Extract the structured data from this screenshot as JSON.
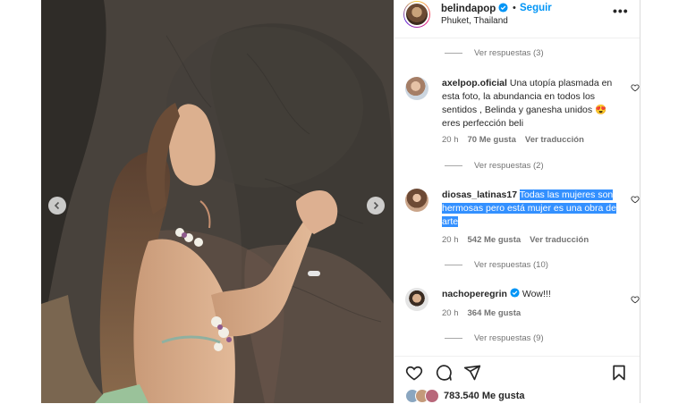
{
  "post": {
    "username": "belindapop",
    "follow_label": "Seguir",
    "dot": "•",
    "location": "Phuket, Thailand",
    "more": "•••"
  },
  "comments": [
    {
      "replies_before": "Ver respuestas (3)"
    },
    {
      "user": "axelpop.oficial",
      "text": "Una utopía plasmada en esta foto, la abundancia en todos los sentidos , Belinda y ganesha unidos 😍 eres perfección beli",
      "time": "20 h",
      "likes": "70 Me gusta",
      "translate": "Ver traducción",
      "replies": "Ver respuestas (2)"
    },
    {
      "user": "diosas_latinas17",
      "text": "Todas las mujeres son hermosas pero está mujer es una obra de arte",
      "time": "20 h",
      "likes": "542 Me gusta",
      "translate": "Ver traducción",
      "replies": "Ver respuestas (10)"
    },
    {
      "user": "nachoperegrin",
      "text": "Wow!!!",
      "time": "20 h",
      "likes": "364 Me gusta",
      "replies": "Ver respuestas (9)"
    }
  ],
  "footer": {
    "likes_count": "783.540 Me gusta"
  },
  "colors": {
    "accent": "#0095f6",
    "verified": "#0095f6",
    "selection": "#3390ff",
    "muted_text": "#737373",
    "text": "#262626"
  },
  "icons": [
    "verified-badge-icon",
    "more-icon",
    "heart-icon",
    "comment-icon",
    "share-icon",
    "save-icon",
    "chevron-left-icon",
    "chevron-right-icon"
  ]
}
